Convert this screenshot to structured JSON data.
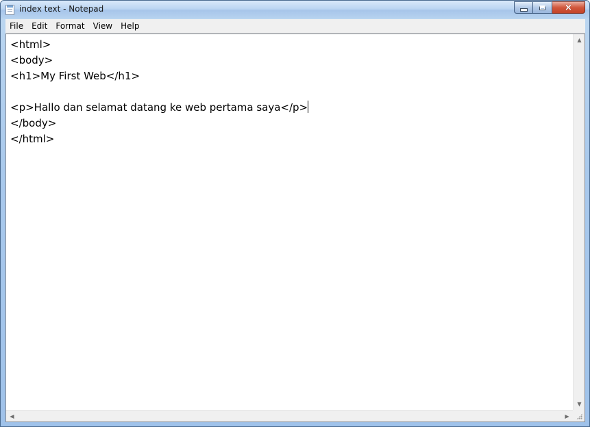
{
  "window": {
    "title": "index text - Notepad",
    "app_icon": "notepad-icon",
    "controls": {
      "minimize": "minimize-icon",
      "maximize": "maximize-icon",
      "close": "×"
    }
  },
  "menu": {
    "items": [
      "File",
      "Edit",
      "Format",
      "View",
      "Help"
    ]
  },
  "editor": {
    "lines": [
      "<html>",
      "<body>",
      "<h1>My First Web</h1>",
      "",
      "<p>Hallo dan selamat datang ke web pertama saya</p>",
      "</body>",
      "</html>"
    ]
  },
  "scrollbars": {
    "up": "▲",
    "down": "▼",
    "left": "◀",
    "right": "▶"
  },
  "colors": {
    "close_button": "#c44227",
    "titlebar": "#bcd6f2",
    "menubar": "#f0f0f0"
  }
}
